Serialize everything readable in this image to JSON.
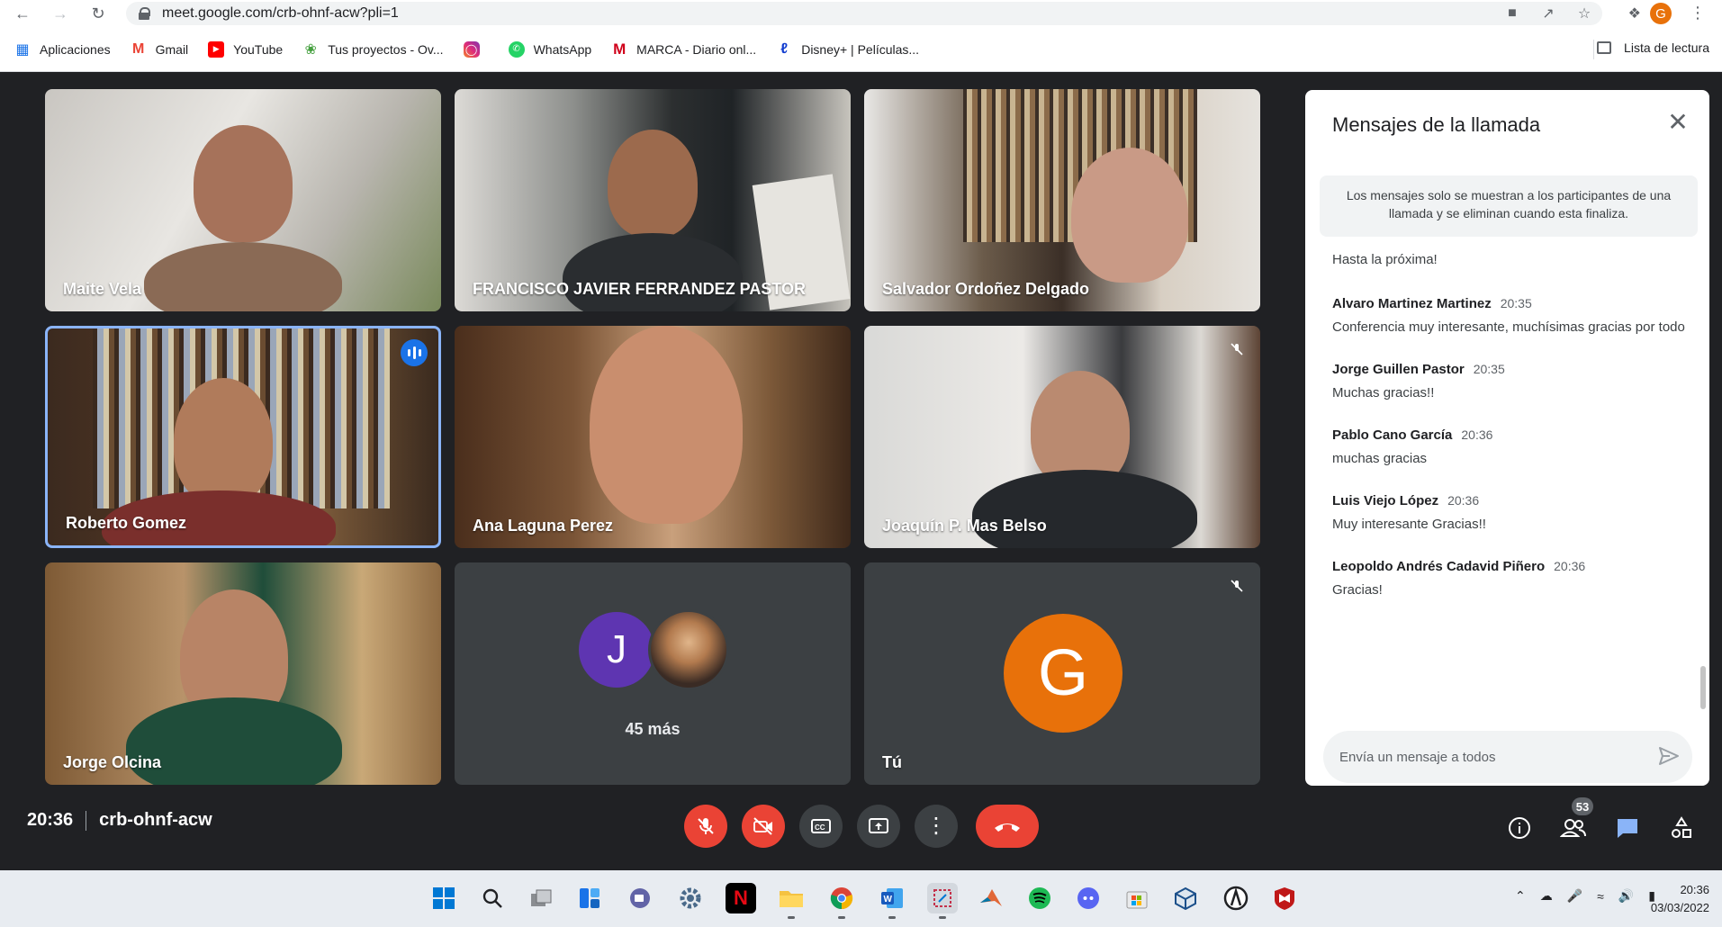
{
  "browser": {
    "url": "meet.google.com/crb-ohnf-acw?pli=1",
    "profile_initial": "G",
    "bookmarks": [
      {
        "label": "Aplicaciones",
        "icon": "apps-grid-icon"
      },
      {
        "label": "Gmail",
        "icon": "gmail-icon"
      },
      {
        "label": "YouTube",
        "icon": "youtube-icon"
      },
      {
        "label": "Tus proyectos - Ov...",
        "icon": "overleaf-icon"
      },
      {
        "label": "",
        "icon": "instagram-icon"
      },
      {
        "label": "WhatsApp",
        "icon": "whatsapp-icon"
      },
      {
        "label": "MARCA - Diario onl...",
        "icon": "marca-icon"
      },
      {
        "label": "Disney+ | Películas...",
        "icon": "disney-icon"
      }
    ],
    "reading_list": "Lista de lectura"
  },
  "participants": [
    {
      "name": "Maite Vela"
    },
    {
      "name": "FRANCISCO JAVIER FERRANDEZ PASTOR"
    },
    {
      "name": "Salvador Ordoñez Delgado"
    },
    {
      "name": "Roberto Gomez"
    },
    {
      "name": "Ana Laguna Perez"
    },
    {
      "name": "Joaquín P. Mas Belso"
    },
    {
      "name": "Jorge Olcina"
    }
  ],
  "more_tile": {
    "avatar_initial": "J",
    "label": "45 más"
  },
  "self_tile": {
    "avatar_initial": "G",
    "label": "Tú"
  },
  "chat": {
    "title": "Mensajes de la llamada",
    "info": "Los mensajes solo se muestran a los participantes de una llamada y se eliminan cuando esta finaliza.",
    "first_line": "Hasta la próxima!",
    "messages": [
      {
        "author": "Alvaro Martinez Martinez",
        "time": "20:35",
        "text": "Conferencia muy interesante, muchísimas gracias por todo"
      },
      {
        "author": "Jorge Guillen Pastor",
        "time": "20:35",
        "text": "Muchas gracias!!"
      },
      {
        "author": "Pablo Cano García",
        "time": "20:36",
        "text": "muchas gracias"
      },
      {
        "author": "Luis Viejo López",
        "time": "20:36",
        "text": "Muy interesante Gracias!!"
      },
      {
        "author": "Leopoldo Andrés Cadavid Piñero",
        "time": "20:36",
        "text": "Gracias!"
      }
    ],
    "input_placeholder": "Envía un mensaje a todos"
  },
  "bottom_bar": {
    "time": "20:36",
    "meeting_code": "crb-ohnf-acw",
    "participants_count": "53"
  },
  "taskbar": {
    "time": "20:36",
    "date": "03/03/2022"
  },
  "colors": {
    "meet_bg": "#202124",
    "tile_bg": "#3c4043",
    "danger": "#ea4335",
    "accent": "#1a73e8",
    "self_avatar": "#e8710a",
    "more_avatar": "#5e35b1"
  }
}
